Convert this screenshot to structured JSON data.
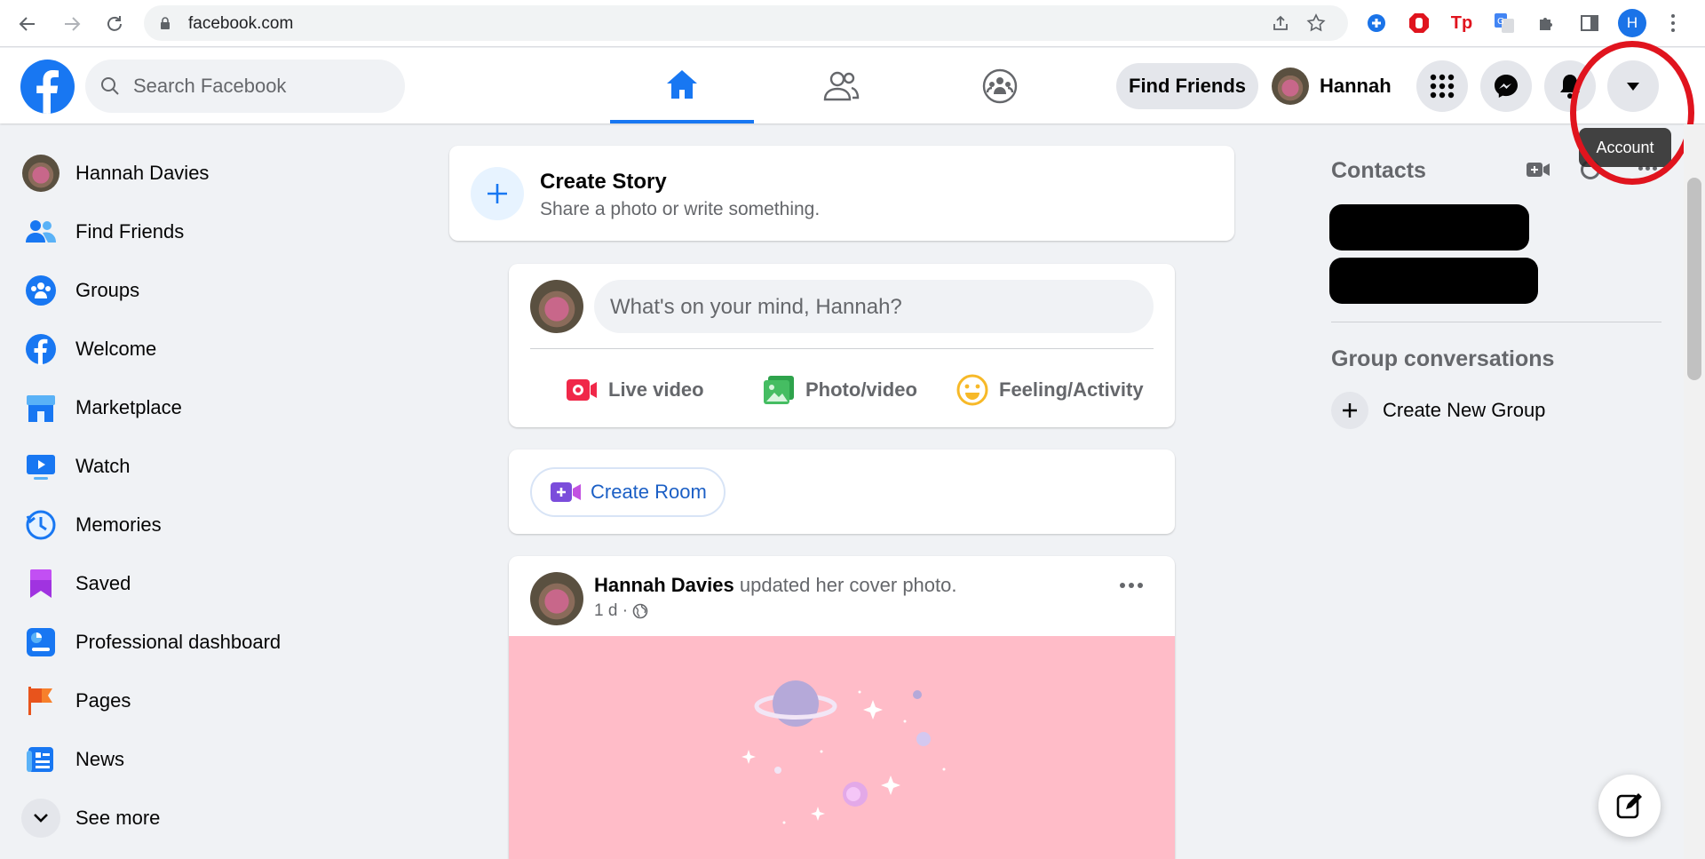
{
  "browser": {
    "url": "facebook.com",
    "profile_initial": "H"
  },
  "topbar": {
    "search_placeholder": "Search Facebook",
    "find_friends_label": "Find Friends",
    "user_name": "Hannah",
    "tooltip": "Account",
    "accent_color": "#1877f2"
  },
  "sidebar": {
    "items": [
      {
        "label": "Hannah Davies",
        "icon": "avatar"
      },
      {
        "label": "Find Friends",
        "icon": "friends-icon"
      },
      {
        "label": "Groups",
        "icon": "groups-icon"
      },
      {
        "label": "Welcome",
        "icon": "facebook-icon"
      },
      {
        "label": "Marketplace",
        "icon": "marketplace-icon"
      },
      {
        "label": "Watch",
        "icon": "watch-icon"
      },
      {
        "label": "Memories",
        "icon": "memories-icon"
      },
      {
        "label": "Saved",
        "icon": "saved-icon"
      },
      {
        "label": "Professional dashboard",
        "icon": "dashboard-icon"
      },
      {
        "label": "Pages",
        "icon": "pages-icon"
      },
      {
        "label": "News",
        "icon": "news-icon"
      },
      {
        "label": "See more",
        "icon": "chevron-down-icon"
      }
    ]
  },
  "feed": {
    "create_story": {
      "title": "Create Story",
      "subtitle": "Share a photo or write something."
    },
    "composer": {
      "placeholder": "What's on your mind, Hannah?",
      "actions": [
        "Live video",
        "Photo/video",
        "Feeling/Activity"
      ]
    },
    "room_label": "Create Room",
    "post": {
      "author": "Hannah Davies",
      "action_text": "updated her cover photo.",
      "time": "1 d ·"
    }
  },
  "right_rail": {
    "contacts_title": "Contacts",
    "group_title": "Group conversations",
    "create_group_label": "Create New Group"
  }
}
